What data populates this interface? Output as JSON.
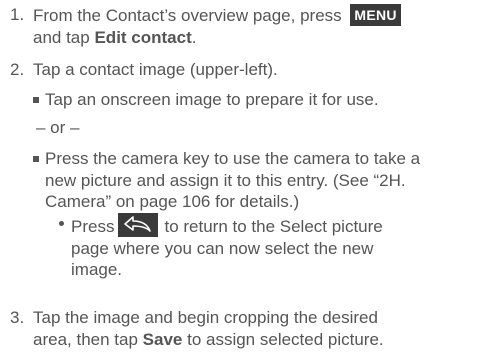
{
  "steps": [
    {
      "number": "1.",
      "text_a": "From the Contact’s overview page, press",
      "key": "MENU",
      "text_b": "and tap",
      "bold": "Edit contact",
      "text_c": "."
    },
    {
      "number": "2.",
      "text": "Tap a contact image (upper-left).",
      "sub_a": "Tap an onscreen image to prepare it for use.",
      "or_text": "– or –",
      "sub_b_line1": "Press the camera key to use the camera to take a",
      "sub_b_line2": "new picture and assign it to this entry. (See “2H.",
      "sub_b_line3": "Camera” on page 106 for details.)",
      "dot_a": "Press",
      "dot_b": "to return to the Select picture",
      "dot_line2": "page where you can now select the new",
      "dot_line3": "image."
    },
    {
      "number": "3.",
      "line1": "Tap the image and begin cropping the desired",
      "line2_a": "area, then tap",
      "bold": "Save",
      "line2_b": "to assign selected picture."
    }
  ],
  "icons": {
    "menu_key": "menu-key",
    "back_key": "back-arrow-icon"
  }
}
